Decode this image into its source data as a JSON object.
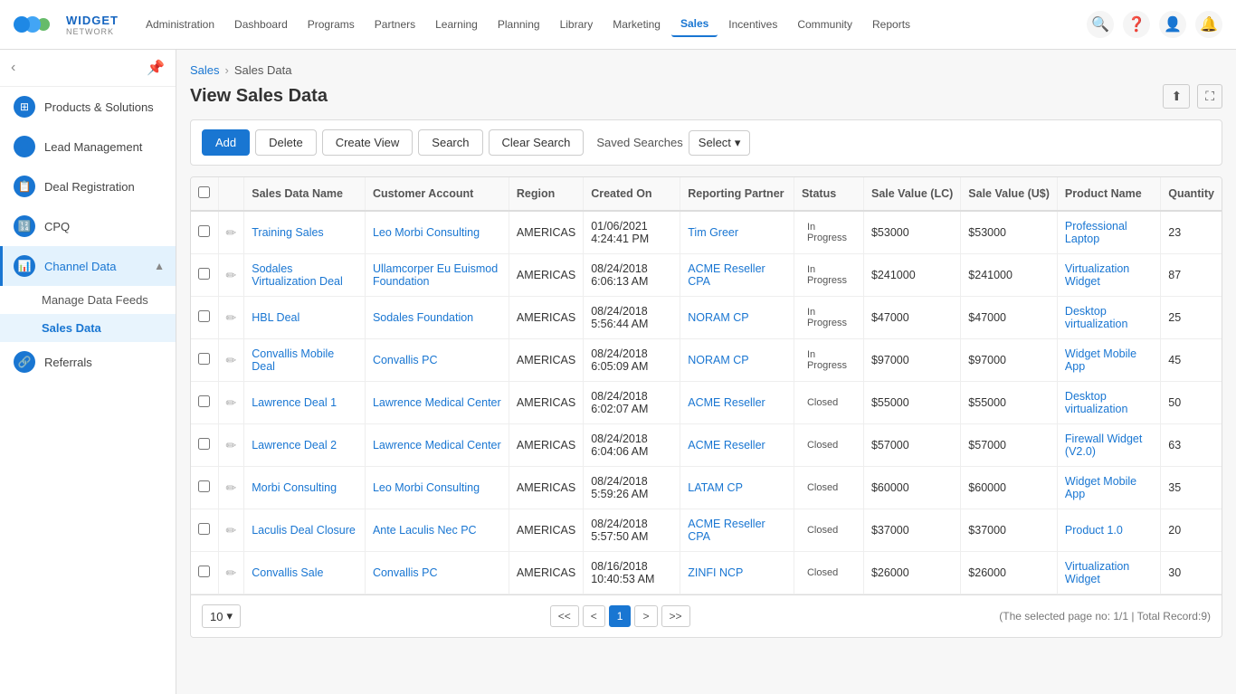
{
  "logo": {
    "name": "WIDGET",
    "sub": "NETWORK"
  },
  "nav": {
    "links": [
      {
        "label": "Administration",
        "active": false
      },
      {
        "label": "Dashboard",
        "active": false
      },
      {
        "label": "Programs",
        "active": false
      },
      {
        "label": "Partners",
        "active": false
      },
      {
        "label": "Learning",
        "active": false
      },
      {
        "label": "Planning",
        "active": false
      },
      {
        "label": "Library",
        "active": false
      },
      {
        "label": "Marketing",
        "active": false
      },
      {
        "label": "Sales",
        "active": true
      },
      {
        "label": "Incentives",
        "active": false
      },
      {
        "label": "Community",
        "active": false
      },
      {
        "label": "Reports",
        "active": false
      }
    ]
  },
  "sidebar": {
    "items": [
      {
        "label": "Products & Solutions",
        "icon": "⊞"
      },
      {
        "label": "Lead Management",
        "icon": "👤"
      },
      {
        "label": "Deal Registration",
        "icon": "📋"
      },
      {
        "label": "CPQ",
        "icon": "🔢"
      },
      {
        "label": "Channel Data",
        "icon": "📊",
        "expanded": true
      }
    ],
    "sub_items": [
      {
        "label": "Manage Data Feeds"
      },
      {
        "label": "Sales Data",
        "active": true
      }
    ],
    "referrals": {
      "label": "Referrals",
      "icon": "🔗"
    }
  },
  "breadcrumb": {
    "parent": "Sales",
    "current": "Sales Data"
  },
  "page": {
    "title": "View Sales Data"
  },
  "toolbar": {
    "add": "Add",
    "delete": "Delete",
    "create_view": "Create View",
    "search": "Search",
    "clear_search": "Clear Search",
    "saved_searches": "Saved Searches",
    "select": "Select"
  },
  "table": {
    "columns": [
      {
        "label": "Select"
      },
      {
        "label": ""
      },
      {
        "label": "Sales Data Name"
      },
      {
        "label": "Customer Account"
      },
      {
        "label": "Region"
      },
      {
        "label": "Created On"
      },
      {
        "label": "Reporting Partner"
      },
      {
        "label": "Status"
      },
      {
        "label": "Sale Value (LC)"
      },
      {
        "label": "Sale Value (U$)"
      },
      {
        "label": "Product Name"
      },
      {
        "label": "Quantity"
      }
    ],
    "rows": [
      {
        "name": "Training Sales",
        "customer": "Leo Morbi Consulting",
        "region": "AMERICAS",
        "created_on": "01/06/2021 4:24:41 PM",
        "reporting_partner": "Tim Greer",
        "status": "In Progress",
        "sale_value_lc": "$53000",
        "sale_value_usd": "$53000",
        "product": "Professional Laptop",
        "quantity": "23"
      },
      {
        "name": "Sodales Virtualization Deal",
        "customer": "Ullamcorper Eu Euismod Foundation",
        "region": "AMERICAS",
        "created_on": "08/24/2018 6:06:13 AM",
        "reporting_partner": "ACME Reseller CPA",
        "status": "In Progress",
        "sale_value_lc": "$241000",
        "sale_value_usd": "$241000",
        "product": "Virtualization Widget",
        "quantity": "87"
      },
      {
        "name": "HBL Deal",
        "customer": "Sodales Foundation",
        "region": "AMERICAS",
        "created_on": "08/24/2018 5:56:44 AM",
        "reporting_partner": "NORAM CP",
        "status": "In Progress",
        "sale_value_lc": "$47000",
        "sale_value_usd": "$47000",
        "product": "Desktop virtualization",
        "quantity": "25"
      },
      {
        "name": "Convallis Mobile Deal",
        "customer": "Convallis PC",
        "region": "AMERICAS",
        "created_on": "08/24/2018 6:05:09 AM",
        "reporting_partner": "NORAM CP",
        "status": "In Progress",
        "sale_value_lc": "$97000",
        "sale_value_usd": "$97000",
        "product": "Widget Mobile App",
        "quantity": "45"
      },
      {
        "name": "Lawrence Deal 1",
        "customer": "Lawrence Medical Center",
        "region": "AMERICAS",
        "created_on": "08/24/2018 6:02:07 AM",
        "reporting_partner": "ACME Reseller",
        "status": "Closed",
        "sale_value_lc": "$55000",
        "sale_value_usd": "$55000",
        "product": "Desktop virtualization",
        "quantity": "50"
      },
      {
        "name": "Lawrence Deal 2",
        "customer": "Lawrence Medical Center",
        "region": "AMERICAS",
        "created_on": "08/24/2018 6:04:06 AM",
        "reporting_partner": "ACME Reseller",
        "status": "Closed",
        "sale_value_lc": "$57000",
        "sale_value_usd": "$57000",
        "product": "Firewall Widget (V2.0)",
        "quantity": "63"
      },
      {
        "name": "Morbi Consulting",
        "customer": "Leo Morbi Consulting",
        "region": "AMERICAS",
        "created_on": "08/24/2018 5:59:26 AM",
        "reporting_partner": "LATAM CP",
        "status": "Closed",
        "sale_value_lc": "$60000",
        "sale_value_usd": "$60000",
        "product": "Widget Mobile App",
        "quantity": "35"
      },
      {
        "name": "Laculis Deal Closure",
        "customer": "Ante Laculis Nec PC",
        "region": "AMERICAS",
        "created_on": "08/24/2018 5:57:50 AM",
        "reporting_partner": "ACME Reseller CPA",
        "status": "Closed",
        "sale_value_lc": "$37000",
        "sale_value_usd": "$37000",
        "product": "Product 1.0",
        "quantity": "20"
      },
      {
        "name": "Convallis Sale",
        "customer": "Convallis PC",
        "region": "AMERICAS",
        "created_on": "08/16/2018 10:40:53 AM",
        "reporting_partner": "ZINFI NCP",
        "status": "Closed",
        "sale_value_lc": "$26000",
        "sale_value_usd": "$26000",
        "product": "Virtualization Widget",
        "quantity": "30"
      }
    ]
  },
  "pagination": {
    "per_page": "10",
    "current_page": "1",
    "total_info": "(The selected page no: 1/1 | Total Record:9)",
    "first": "<<",
    "prev": "<",
    "next": ">",
    "last": ">>"
  }
}
